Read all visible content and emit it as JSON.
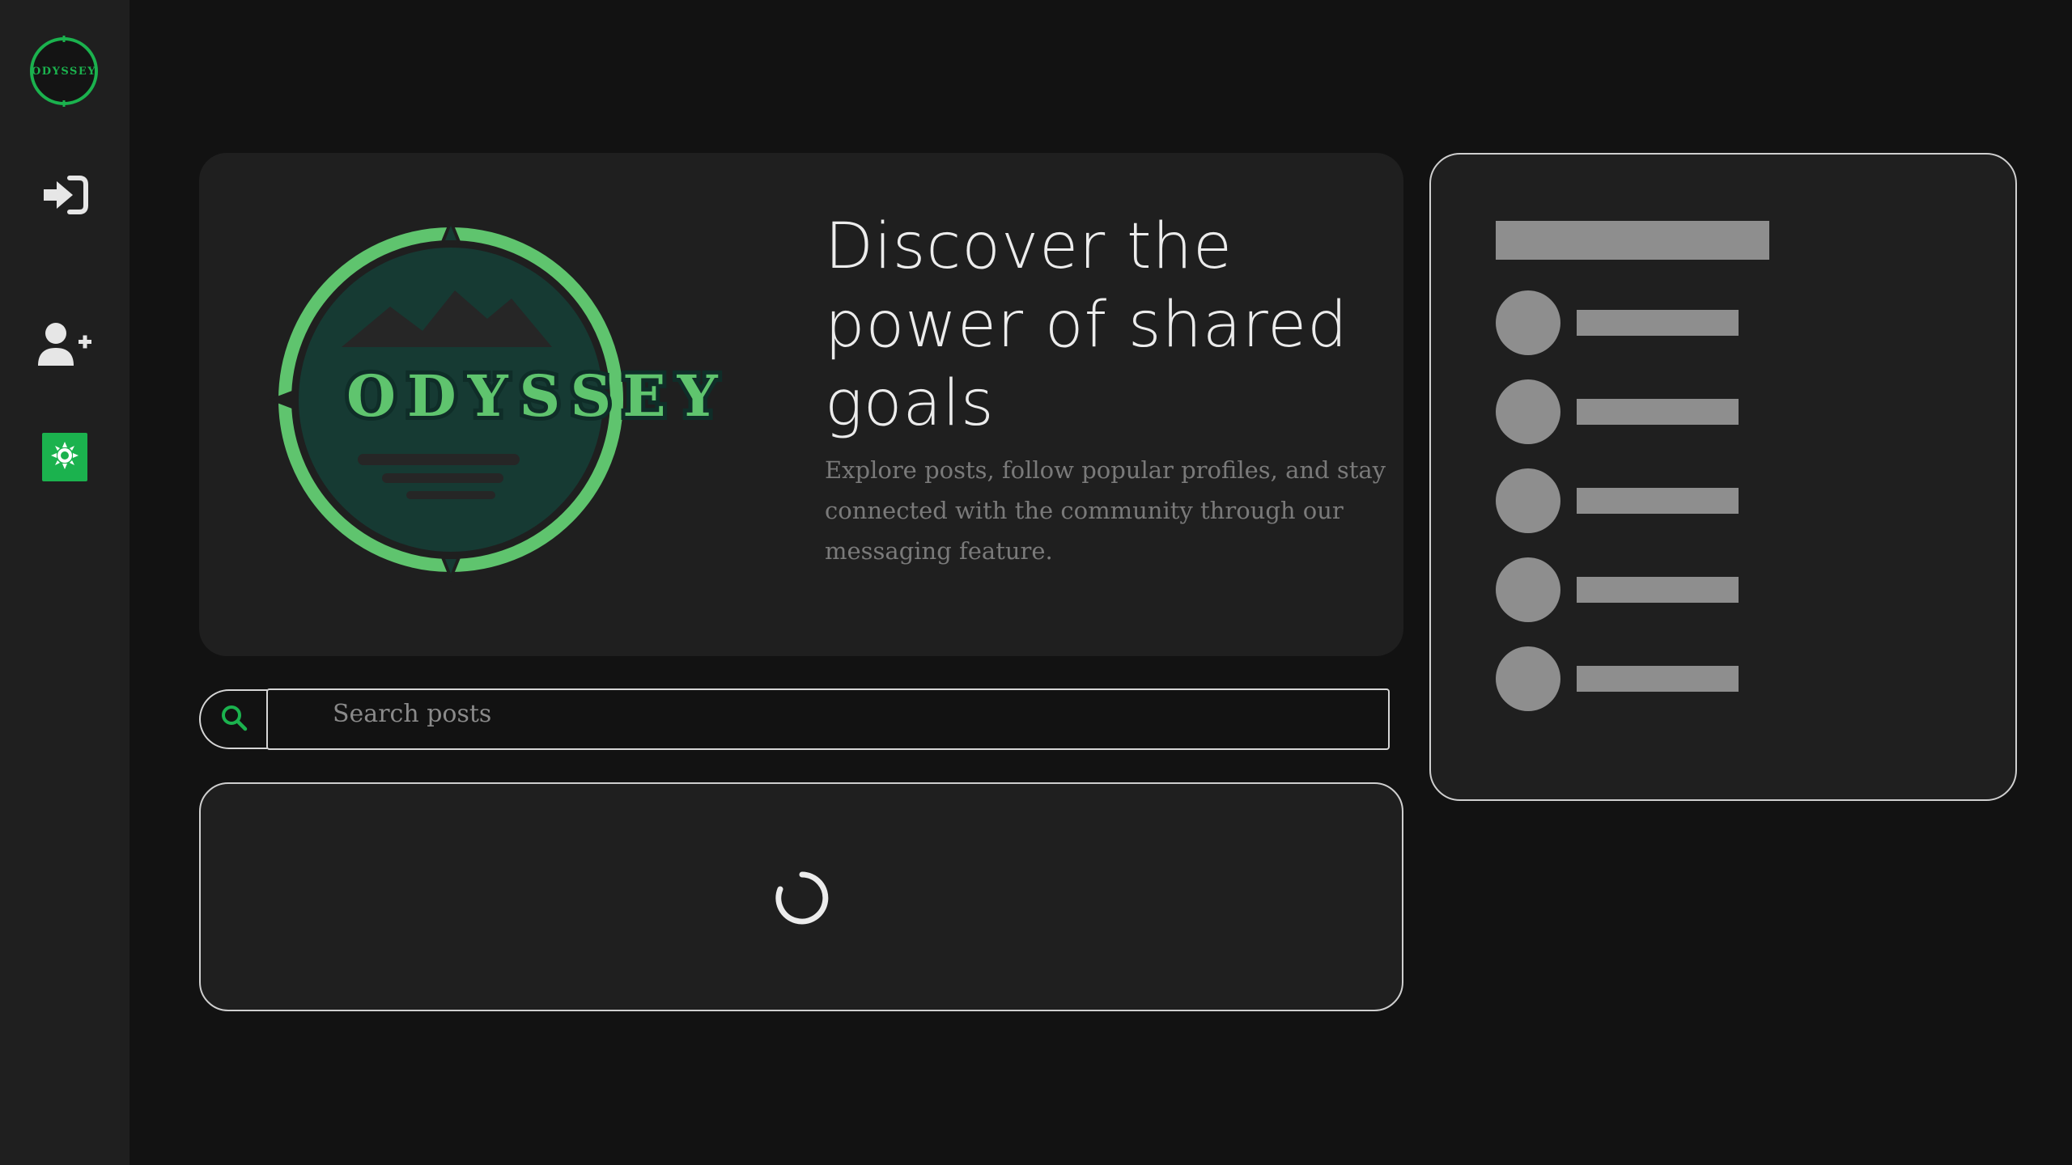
{
  "colors": {
    "background": "#121212",
    "panel": "#1f1f1f",
    "accent_green": "#5fc46e",
    "accent_green_dark": "#1bb24e",
    "skeleton": "#8e8e8e"
  },
  "sidebar": {
    "logo_text": "ODYSSEY",
    "items": [
      {
        "icon": "sign-in-icon",
        "label": ""
      },
      {
        "icon": "user-plus-icon",
        "label": ""
      },
      {
        "icon": "theme-toggle-icon",
        "label": ""
      }
    ]
  },
  "hero": {
    "logo_text": "ODYSSEY",
    "title": "Discover the power of shared goals",
    "subtitle": "Explore posts, follow popular profiles, and stay connected with the community through our messaging feature."
  },
  "search": {
    "placeholder": "Search posts",
    "value": ""
  },
  "feed": {
    "state": "loading"
  },
  "right_panel": {
    "state": "loading",
    "skeleton_rows": 5
  }
}
